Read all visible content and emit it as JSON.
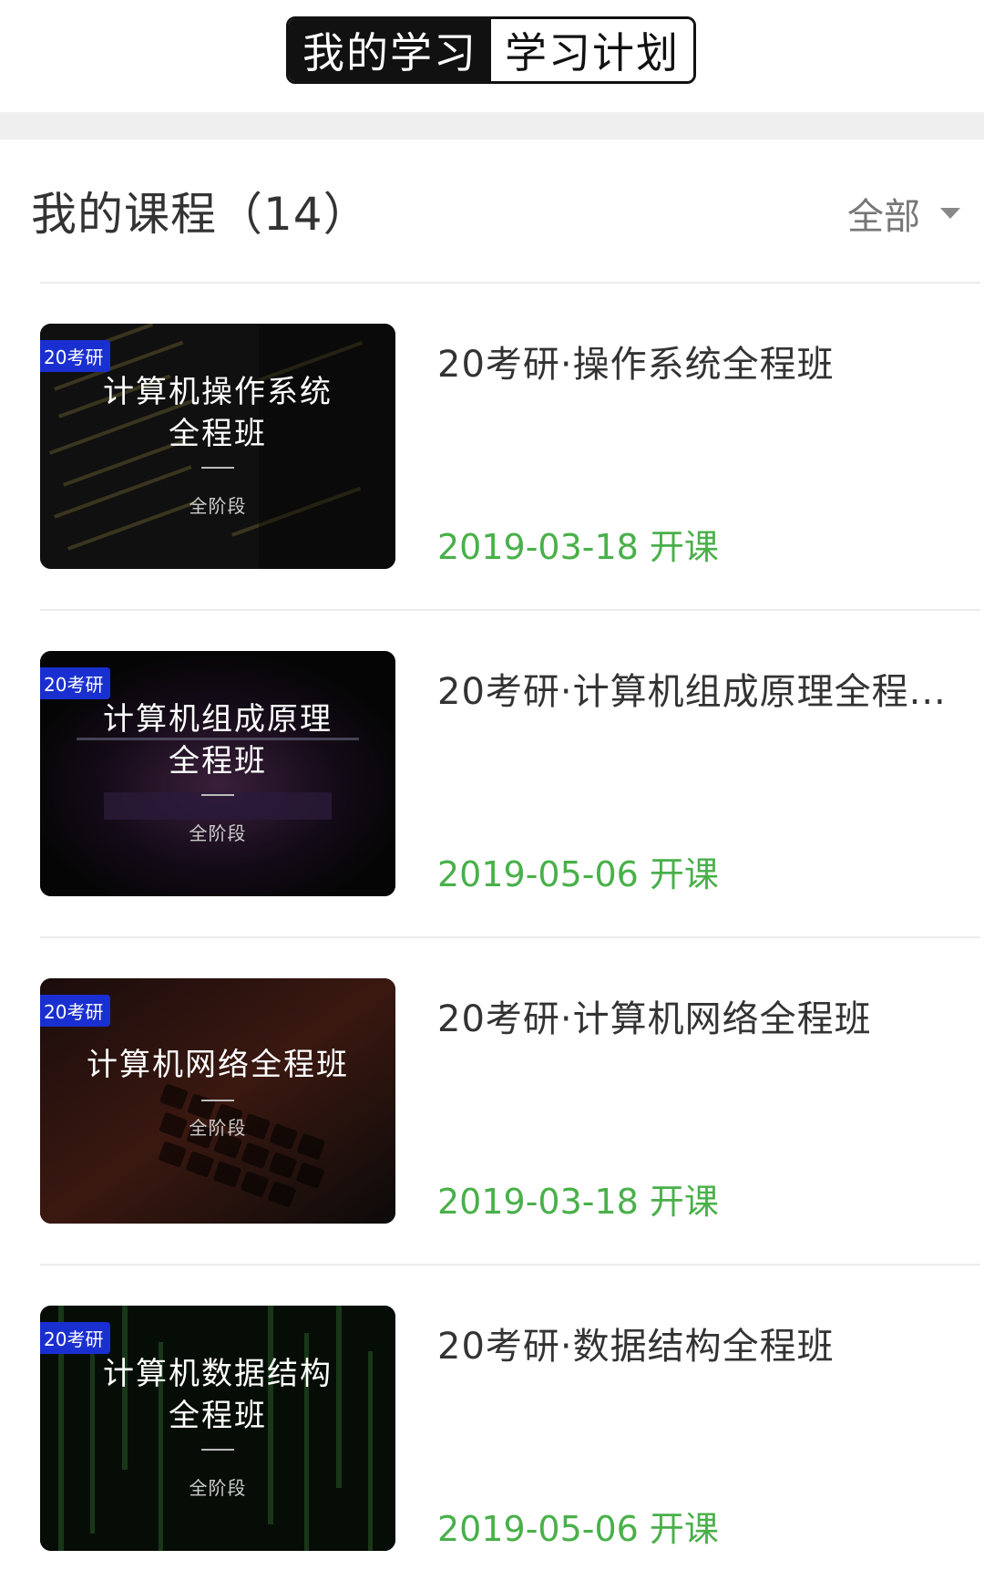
{
  "tabs": [
    {
      "label": "我的学习",
      "active": true
    },
    {
      "label": "学习计划",
      "active": false
    }
  ],
  "header": {
    "title": "我的课程（14）",
    "filter_label": "全部"
  },
  "courses": [
    {
      "tag": "20考研",
      "thumb_title": "计算机操作系统\n全程班",
      "thumb_sub": "全阶段",
      "title": "20考研·操作系统全程班",
      "date": "2019-03-18 开课"
    },
    {
      "tag": "20考研",
      "thumb_title": "计算机组成原理\n全程班",
      "thumb_sub": "全阶段",
      "title": "20考研·计算机组成原理全程...",
      "date": "2019-05-06 开课"
    },
    {
      "tag": "20考研",
      "thumb_title": "计算机网络全程班",
      "thumb_sub": "全阶段",
      "title": "20考研·计算机网络全程班",
      "date": "2019-03-18 开课"
    },
    {
      "tag": "20考研",
      "thumb_title": "计算机数据结构\n全程班",
      "thumb_sub": "全阶段",
      "title": "20考研·数据结构全程班",
      "date": "2019-05-06 开课"
    }
  ],
  "colors": {
    "date_green": "#49b04a",
    "tag_blue": "#1a2fd0"
  }
}
